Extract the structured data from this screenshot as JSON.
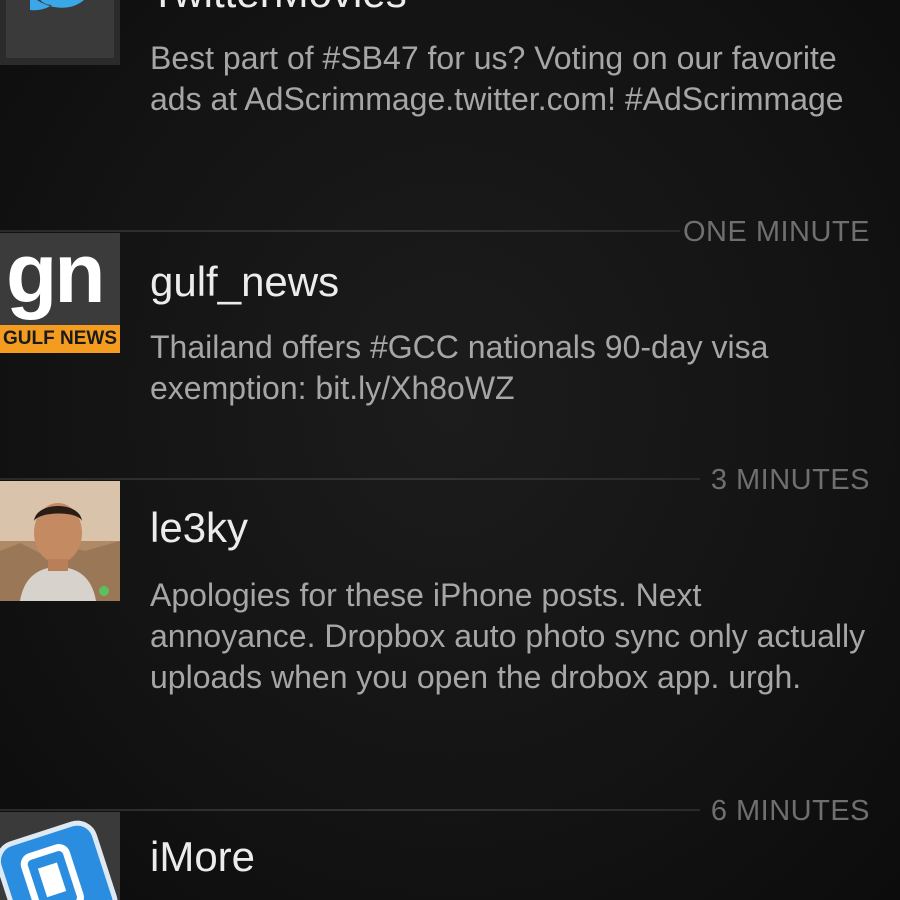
{
  "tweets": [
    {
      "username": "TwitterMovies",
      "text": "Best part of #SB47 for us? Voting on our favorite ads at AdScrimmage.twitter.com! #AdScrimmage",
      "time": "",
      "avatar_icon": "twitter-bird-icon",
      "accent": "#1da1f2"
    },
    {
      "username": "gulf_news",
      "text": "Thailand offers #GCC nationals 90-day visa exemption: bit.ly/Xh8oWZ",
      "time": "ONE MINUTE",
      "avatar_icon": "gulf-news-logo",
      "avatar_text": "gn",
      "avatar_subtext": "GULF NEWS",
      "accent": "#f39c1f"
    },
    {
      "username": "le3ky",
      "text": "Apologies for these iPhone posts. Next annoyance. Dropbox auto photo sync only actually uploads when you open the drobox app. urgh.",
      "time": "3 MINUTES",
      "avatar_icon": "user-photo-avatar"
    },
    {
      "username": "iMore",
      "text": "",
      "time": "6 MINUTES",
      "avatar_icon": "imore-logo",
      "accent": "#2a8de0"
    }
  ]
}
